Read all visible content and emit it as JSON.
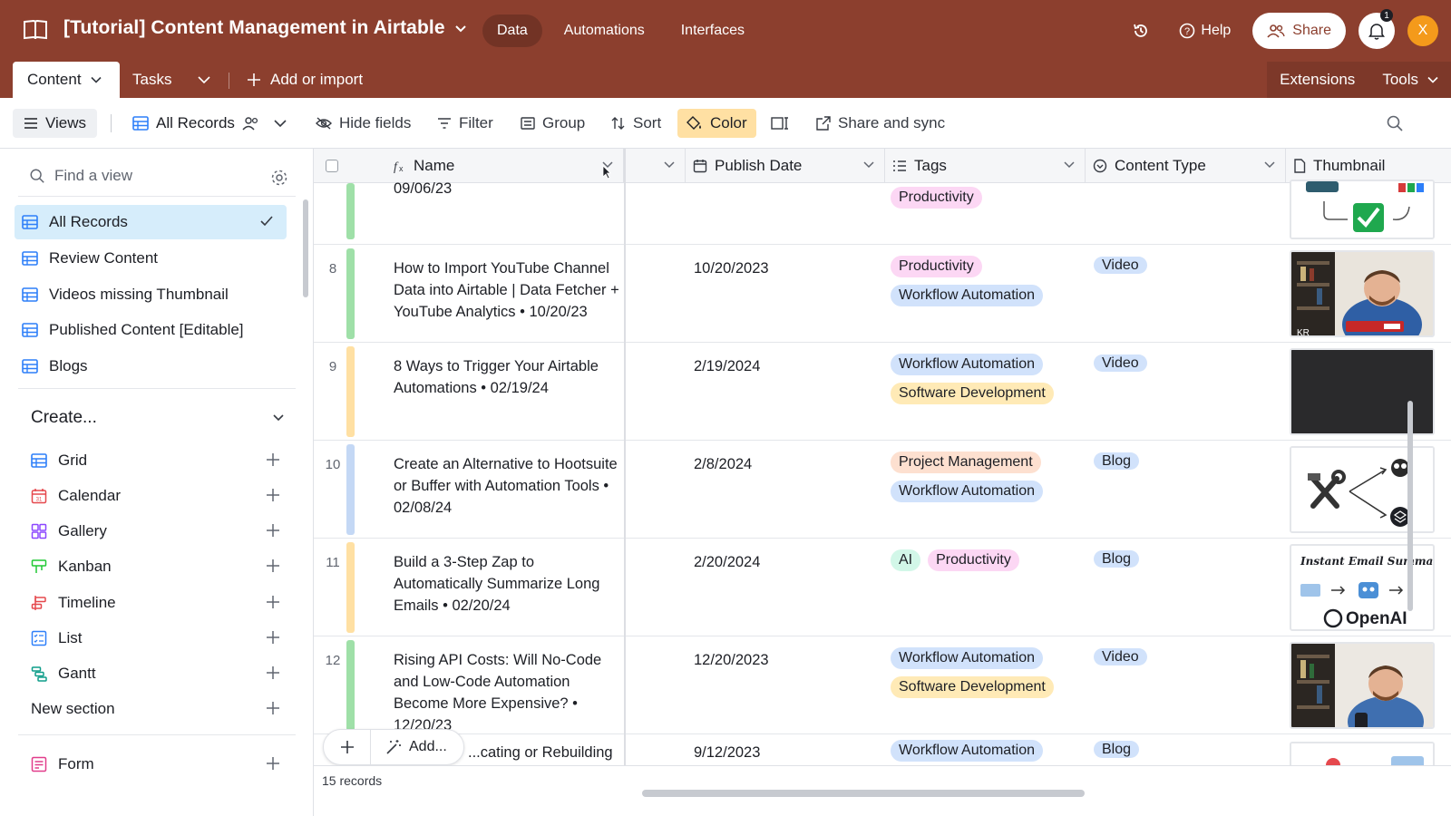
{
  "topbar": {
    "base_title": "[Tutorial] Content Management in Airtable",
    "tabs": [
      "Data",
      "Automations",
      "Interfaces"
    ],
    "help": "Help",
    "share": "Share",
    "notification_count": "1",
    "avatar_initial": "X",
    "brand_color": "#8c3f2e"
  },
  "tablebar": {
    "active_table": "Content",
    "other_table": "Tasks",
    "add_import": "Add or import",
    "extensions": "Extensions",
    "tools": "Tools"
  },
  "viewbar": {
    "views": "Views",
    "current_view": "All Records",
    "hide_fields": "Hide fields",
    "filter": "Filter",
    "group": "Group",
    "sort": "Sort",
    "color": "Color",
    "share_sync": "Share and sync"
  },
  "sidebar": {
    "find_placeholder": "Find a view",
    "views": [
      {
        "label": "All Records",
        "active": true
      },
      {
        "label": "Review Content"
      },
      {
        "label": "Videos missing Thumbnail"
      },
      {
        "label": "Published Content [Editable]"
      },
      {
        "label": "Blogs"
      }
    ],
    "create_heading": "Create...",
    "create_items": [
      "Grid",
      "Calendar",
      "Gallery",
      "Kanban",
      "Timeline",
      "List",
      "Gantt",
      "New section",
      "Form"
    ]
  },
  "grid": {
    "columns": [
      "Name",
      "Publish Date",
      "Tags",
      "Content Type",
      "Thumbnail"
    ],
    "partial_top": {
      "name": "09/06/23",
      "tags": [
        "Productivity"
      ]
    },
    "rows": [
      {
        "num": "8",
        "bar": "#9fe0a8",
        "name": "How to Import YouTube Channel Data into Airtable | Data Fetcher + YouTube Analytics • 10/20/23",
        "date": "10/20/2023",
        "tags": [
          "Productivity",
          "Workflow Automation"
        ],
        "type": "Video"
      },
      {
        "num": "9",
        "bar": "#ffe0a3",
        "name": "8 Ways to Trigger Your Airtable Automations • 02/19/24",
        "date": "2/19/2024",
        "tags": [
          "Workflow Automation",
          "Software Development"
        ],
        "type": "Video"
      },
      {
        "num": "10",
        "bar": "#c4d8f5",
        "name": "Create an Alternative to Hootsuite or Buffer with Automation Tools • 02/08/24",
        "date": "2/8/2024",
        "tags": [
          "Project Management",
          "Workflow Automation"
        ],
        "type": "Blog"
      },
      {
        "num": "11",
        "bar": "#ffe0a3",
        "name": "Build a 3-Step Zap to Automatically Summarize Long Emails • 02/20/24",
        "date": "2/20/2024",
        "tags": [
          "AI",
          "Productivity"
        ],
        "type": "Blog"
      },
      {
        "num": "12",
        "bar": "#9fe0a8",
        "name": "Rising API Costs: Will No-Code and Low-Code Automation Become More Expensive? • 12/20/23",
        "date": "12/20/2023",
        "tags": [
          "Workflow Automation",
          "Software Development"
        ],
        "type": "Video"
      },
      {
        "num": "",
        "bar": "",
        "name": "...cating or Rebuilding",
        "date": "9/12/2023",
        "tags": [
          "Workflow Automation"
        ],
        "type": "Blog"
      }
    ],
    "thumb_text_email": "Instant Email Summari",
    "thumb_text_openai": "OpenAI",
    "add_label": "Add...",
    "records_count": "15 records"
  },
  "tag_colors": {
    "Productivity": "#fcd7f4",
    "Workflow Automation": "#d1e2fb",
    "Software Development": "#ffeab6",
    "Project Management": "#fde0d0",
    "AI": "#d2f7e8",
    "Video": "#d1e2fb",
    "Blog": "#d1e2fb"
  }
}
